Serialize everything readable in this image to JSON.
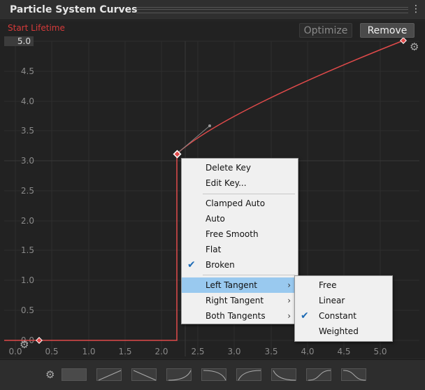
{
  "window": {
    "title": "Particle System Curves"
  },
  "curve": {
    "label": "Start Lifetime",
    "color": "#e04a4a",
    "y_max_field": "5.0"
  },
  "buttons": {
    "optimize": "Optimize",
    "remove": "Remove"
  },
  "axes": {
    "y_ticks": [
      "4.5",
      "4.0",
      "3.5",
      "3.0",
      "2.5",
      "2.0",
      "1.5",
      "1.0",
      "0.5",
      "0.0"
    ],
    "x_ticks": [
      "0.0",
      "0.5",
      "1.0",
      "1.5",
      "2.0",
      "2.5",
      "3.0",
      "3.5",
      "4.0",
      "4.5",
      "5.0"
    ]
  },
  "context_menu": {
    "items": [
      {
        "label": "Delete Key"
      },
      {
        "label": "Edit Key..."
      },
      {
        "label": "Clamped Auto"
      },
      {
        "label": "Auto"
      },
      {
        "label": "Free Smooth"
      },
      {
        "label": "Flat"
      },
      {
        "label": "Broken",
        "checked": true
      },
      {
        "label": "Left Tangent",
        "submenu": true,
        "highlighted": true
      },
      {
        "label": "Right Tangent",
        "submenu": true
      },
      {
        "label": "Both Tangents",
        "submenu": true
      }
    ]
  },
  "submenu": {
    "items": [
      {
        "label": "Free"
      },
      {
        "label": "Linear"
      },
      {
        "label": "Constant",
        "checked": true
      },
      {
        "label": "Weighted"
      }
    ]
  },
  "icons": {
    "check": "check-icon",
    "submenu_arrow": "chevron-right-icon",
    "gear": "gear-icon",
    "menu": "kebab-menu-icon"
  }
}
